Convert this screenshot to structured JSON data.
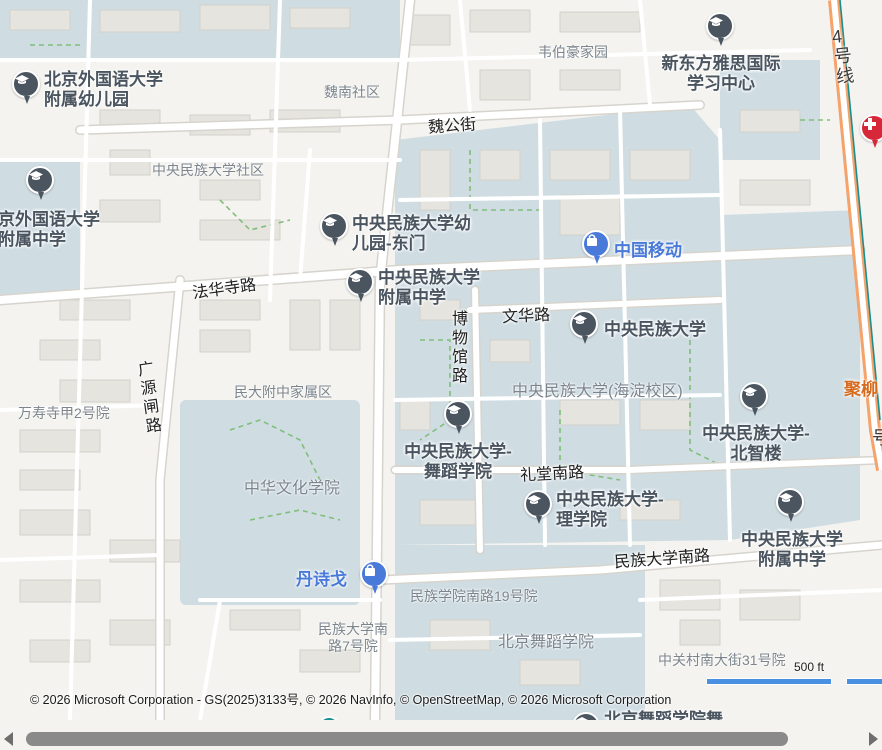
{
  "colors": {
    "campus": "#cfdde3",
    "road": "#ffffff",
    "metro_line": "#f5a26b",
    "metro_inner": "#1a8f8f",
    "poi_school": "#4a5560",
    "poi_shop": "#4a7ad9",
    "poi_hospital": "#d62839"
  },
  "roads": {
    "weigong": "魏公街",
    "fahuasi": "法华寺路",
    "wenhua": "文华路",
    "bowuguan": "博物馆路",
    "guangyuanzha": "广源闸路",
    "litangnan": "礼堂南路",
    "minzudaxuenan": "民族大学南路"
  },
  "metro": {
    "line4": "4号线",
    "partial": "号"
  },
  "areas": {
    "weibohaojia": "韦伯豪家园",
    "weinan": "魏南社区",
    "minda_community": "中央民族大学社区",
    "minda_fuzhong_jiashu": "民大附中家属区",
    "wanshousi": "万寿寺甲2号院",
    "minda_haidian": "中央民族大学(海淀校区)",
    "zhonghua_wenhua": "中华文化学院",
    "minzuxueyuan_19": "民族学院南路19号院",
    "minda_nan7": "民族大学南路7号院",
    "beijing_wudao": "北京舞蹈学院",
    "zhongguancun_31": "中关村南大街31号院"
  },
  "pois": {
    "bfsu_kindergarten": "北京外国语大学附属幼儿园",
    "bfsu_middle": "京外国语大学附属中学",
    "xdf": "新东方雅思国际学习中心",
    "minda_kindergarten": "中央民族大学幼儿园-东门",
    "minda_fuzhong": "中央民族大学附属中学",
    "china_mobile": "中国移动",
    "minda": "中央民族大学",
    "minda_dance": "中央民族大学-舞蹈学院",
    "minda_beizhilou": "中央民族大学-北智楼",
    "minda_science": "中央民族大学-理学院",
    "minda_fuzhong2": "中央民族大学附属中学",
    "danshige": "丹诗戈",
    "jiuliu": "聚柳",
    "wudao_partial": "北京舞蹈学院舞"
  },
  "scale": {
    "label": "500 ft"
  },
  "attribution": "© 2026 Microsoft Corporation - GS(2025)3133号, © 2026 NavInfo,   © OpenStreetMap, © 2026 Microsoft Corporation"
}
